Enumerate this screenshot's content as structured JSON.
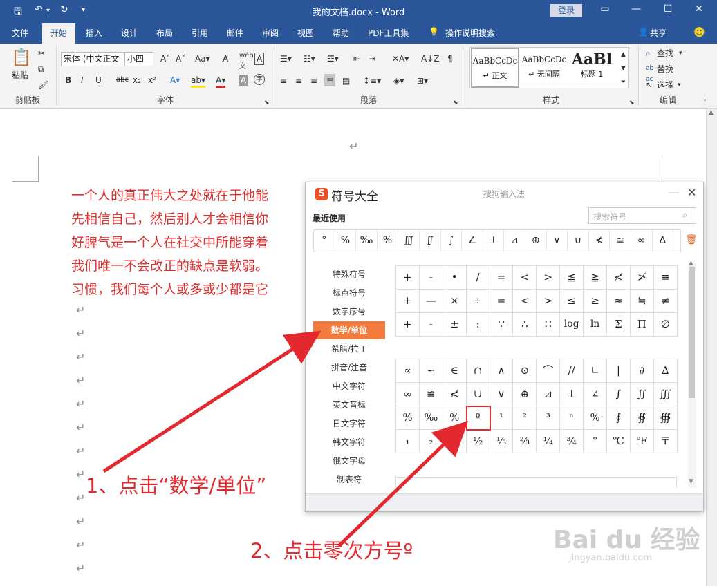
{
  "window": {
    "title": "我的文档.docx  -  Word",
    "login_label": "登录",
    "controls": [
      "▭",
      "—",
      "☐",
      "✕"
    ]
  },
  "quick_access": {
    "icons": [
      "save-icon",
      "undo-icon",
      "redo-icon",
      "customize-icon"
    ]
  },
  "tabs": [
    "文件",
    "开始",
    "插入",
    "设计",
    "布局",
    "引用",
    "邮件",
    "审阅",
    "视图",
    "帮助",
    "PDF工具集",
    "操作说明搜索"
  ],
  "active_tab": "开始",
  "share_label": "共享",
  "ribbon": {
    "clipboard": {
      "label": "剪贴板",
      "paste": "粘贴"
    },
    "font": {
      "label": "字体",
      "font_name": "宋体 (中文正文",
      "font_size": "小四",
      "buttons": [
        "B",
        "I",
        "U",
        "abc",
        "x₂",
        "x²"
      ]
    },
    "paragraph": {
      "label": "段落"
    },
    "styles": {
      "label": "样式",
      "items": [
        {
          "preview": "AaBbCcDc",
          "name": "↵ 正文"
        },
        {
          "preview": "AaBbCcDc",
          "name": "↵ 无间隔"
        },
        {
          "preview": "AaBl",
          "name": "标题 1"
        }
      ]
    },
    "editing": {
      "label": "编辑",
      "find": "查找",
      "replace": "替换",
      "select": "选择"
    }
  },
  "document": {
    "paragraphs": [
      "一个人的真正伟大之处就在于他能",
      "先相信自己，然后别人才会相信你",
      "好脾气是一个人在社交中所能穿着",
      "我们唯一不会改正的缺点是软弱。",
      "习惯，我们每个人或多或少都是它"
    ],
    "para_mark": "↵"
  },
  "symbol_panel": {
    "title": "符号大全",
    "subtitle": "搜狗输入法",
    "logo": "S",
    "recent_label": "最近使用",
    "search_placeholder": "搜索符号",
    "recent": [
      "°",
      "%",
      "‰",
      "%",
      "∭",
      "∬",
      "∫",
      "∠",
      "⊥",
      "⊿",
      "⊕",
      "∨",
      "∪",
      "≮",
      "≌",
      "∞",
      "∆"
    ],
    "categories": [
      "特殊符号",
      "标点符号",
      "数字序号",
      "数学/单位",
      "希腊/拉丁",
      "拼音/注音",
      "中文字符",
      "英文音标",
      "日文字符",
      "韩文字符",
      "俄文字母",
      "制表符"
    ],
    "active_category": "数学/单位",
    "grid1": [
      "+",
      "-",
      "•",
      "/",
      "=",
      "<",
      ">",
      "≦",
      "≧",
      "≮",
      "≯",
      "≡",
      "+",
      "—",
      "×",
      "÷",
      "=",
      "<",
      ">",
      "≤",
      "≥",
      "≈",
      "≒",
      "≠",
      "+",
      "-",
      "±",
      ":",
      "∵",
      "∴",
      "∷",
      "log",
      "ln",
      "Σ",
      "Π",
      "∅"
    ],
    "grid2": [
      "∝",
      "∽",
      "∈",
      "∩",
      "∧",
      "⊙",
      "⌒",
      "//",
      "∟",
      "|",
      "∂",
      "∆",
      "∞",
      "≌",
      "≮",
      "∪",
      "∨",
      "⊕",
      "⊿",
      "⊥",
      "∠",
      "∫",
      "∬",
      "∭",
      "%",
      "‰",
      "%",
      "º",
      "¹",
      "²",
      "³",
      "ⁿ",
      "%",
      "∮",
      "∯",
      "∰",
      "₁",
      "₂",
      "₃",
      "½",
      "⅓",
      "⅔",
      "¼",
      "¾",
      "°",
      "℃",
      "℉",
      "〒"
    ],
    "highlighted": "º"
  },
  "annotations": {
    "step1": "1、点击“数学/单位”",
    "step2": "2、点击零次方号º"
  },
  "watermark": {
    "brand": "Bai du 经验",
    "url": "jingyan.baidu.com"
  }
}
